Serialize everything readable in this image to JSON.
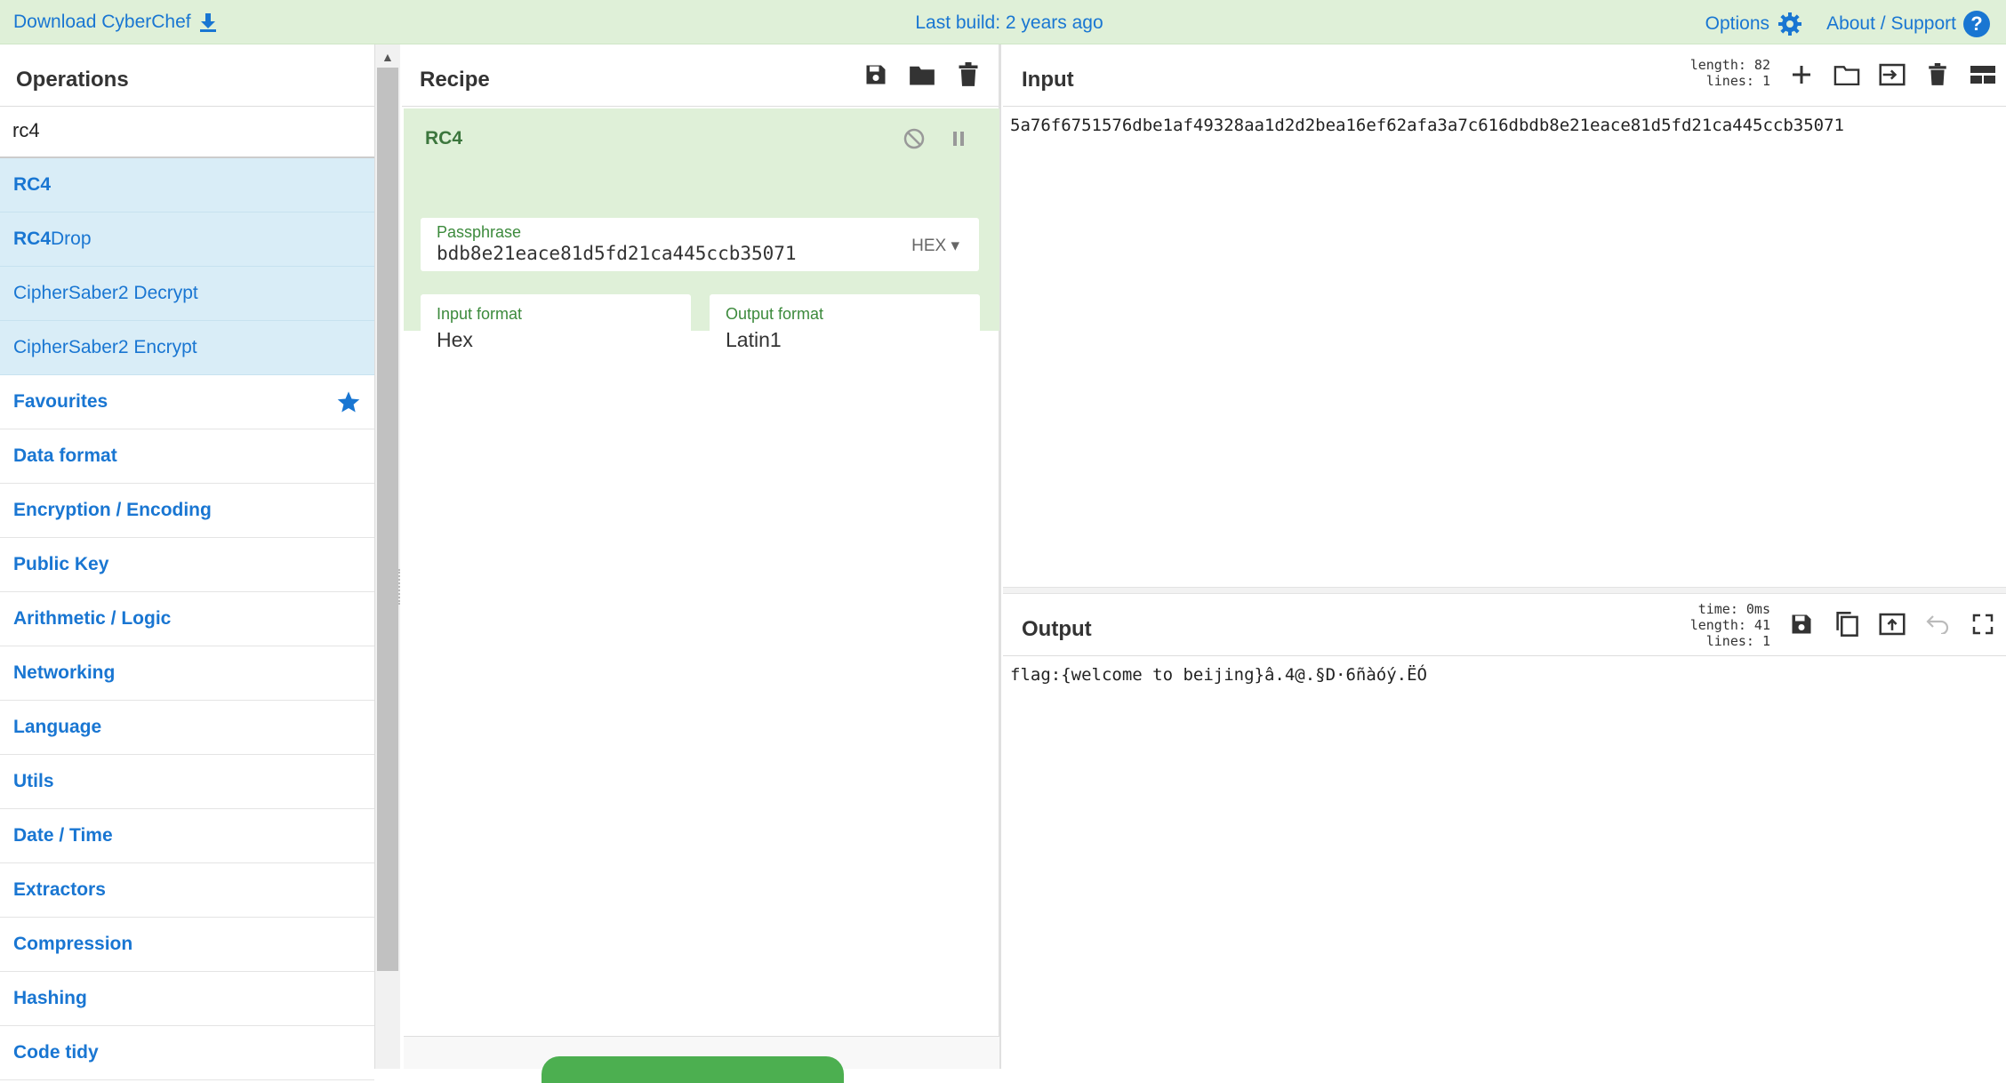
{
  "banner": {
    "download_label": "Download CyberChef",
    "last_build": "Last build: 2 years ago",
    "options_label": "Options",
    "about_label": "About / Support",
    "help_glyph": "?"
  },
  "operations": {
    "title": "Operations",
    "search_value": "rc4",
    "results": [
      {
        "bold": "RC4",
        "rest": ""
      },
      {
        "bold": "RC4",
        "rest": " Drop"
      },
      {
        "bold": "",
        "rest": "CipherSaber2 Decrypt"
      },
      {
        "bold": "",
        "rest": "CipherSaber2 Encrypt"
      }
    ],
    "categories": [
      "Favourites",
      "Data format",
      "Encryption / Encoding",
      "Public Key",
      "Arithmetic / Logic",
      "Networking",
      "Language",
      "Utils",
      "Date / Time",
      "Extractors",
      "Compression",
      "Hashing",
      "Code tidy"
    ]
  },
  "recipe": {
    "title": "Recipe",
    "ingredient": {
      "name": "RC4",
      "passphrase_label": "Passphrase",
      "passphrase_value": "bdb8e21eace81d5fd21ca445ccb35071",
      "passphrase_format": "HEX",
      "input_format_label": "Input format",
      "input_format_value": "Hex",
      "output_format_label": "Output format",
      "output_format_value": "Latin1"
    }
  },
  "input": {
    "title": "Input",
    "length_line": "length: 82",
    "lines_line": "lines:  1",
    "text": "5a76f6751576dbe1af49328aa1d2d2bea16ef62afa3a7c616dbdb8e21eace81d5fd21ca445ccb35071"
  },
  "output": {
    "title": "Output",
    "time_line": "time:  0ms",
    "length_line": "length:  41",
    "lines_line": "lines:  1",
    "text": "flag:{welcome to beijing}â.4@.§D·6ñàóý.ËÓ"
  },
  "colors": {
    "accent": "#1976d2",
    "banner_bg": "#dff0d8",
    "ingredient_bg": "#dff0d8",
    "found_bg": "#d9edf7",
    "ingredient_text": "#3c763d"
  }
}
